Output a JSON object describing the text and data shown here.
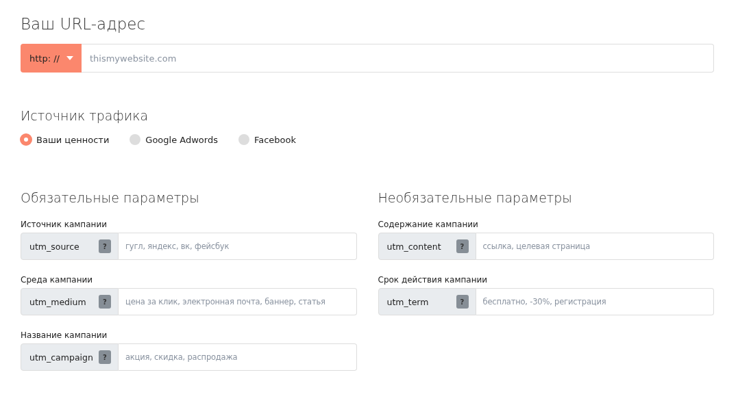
{
  "url_section": {
    "title": "Ваш URL-адрес",
    "protocol": "http: //",
    "placeholder": "thismywebsite.com"
  },
  "traffic_source": {
    "title": "Источник трафика",
    "options": [
      {
        "label": "Ваши ценности",
        "selected": true
      },
      {
        "label": "Google Adwords",
        "selected": false
      },
      {
        "label": "Facebook",
        "selected": false
      }
    ]
  },
  "columns": [
    {
      "title": "Обязательные параметры",
      "fields": [
        {
          "label": "Источник кампании",
          "param": "utm_source",
          "help": "?",
          "placeholder": "гугл, яндекс, вк, фейсбук"
        },
        {
          "label": "Среда кампании",
          "param": "utm_medium",
          "help": "?",
          "placeholder": "цена за клик, электронная почта, баннер, статья"
        },
        {
          "label": "Название кампании",
          "param": "utm_campaign",
          "help": "?",
          "placeholder": "акция, скидка, распродажа"
        }
      ]
    },
    {
      "title": "Необязательные параметры",
      "fields": [
        {
          "label": "Содержание кампании",
          "param": "utm_content",
          "help": "?",
          "placeholder": "ссылка, целевая страница"
        },
        {
          "label": "Срок действия кампании",
          "param": "utm_term",
          "help": "?",
          "placeholder": "бесплатно, -30%, регистрация"
        }
      ]
    }
  ]
}
